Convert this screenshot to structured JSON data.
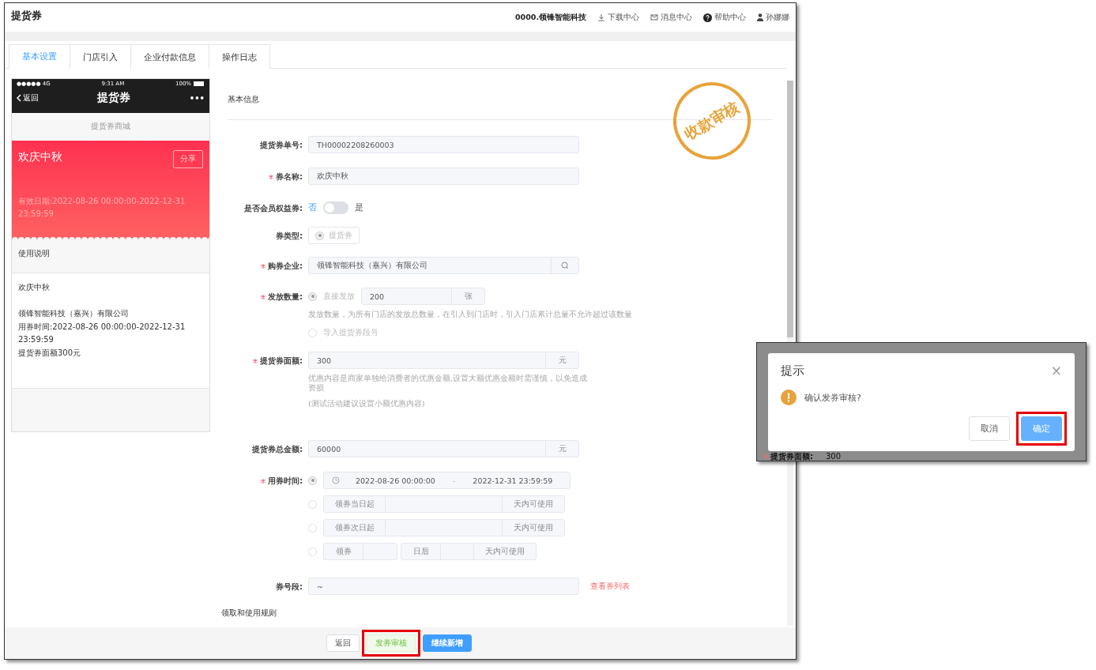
{
  "page_title": "提货券",
  "header_links": [
    {
      "kind": "company",
      "text": "0000.领锋智能科技"
    },
    {
      "kind": "download",
      "text": "下载中心"
    },
    {
      "kind": "message",
      "text": "消息中心"
    },
    {
      "kind": "help",
      "text": "帮助中心"
    },
    {
      "kind": "user",
      "text": "孙娜娜"
    }
  ],
  "tabs": [
    {
      "label": "基本设置",
      "selected": true
    },
    {
      "label": "门店引入",
      "selected": false
    },
    {
      "label": "企业付款信息",
      "selected": false
    },
    {
      "label": "操作日志",
      "selected": false
    }
  ],
  "stamp": "收款审核",
  "phone": {
    "carrier": "●●●●● 4G",
    "time": "9:31 AM",
    "battery": "100%",
    "back": "返回",
    "title": "提货券",
    "more": "•••",
    "shop_label": "提货券商城",
    "coupon": {
      "name": "欢庆中秋",
      "share": "分享",
      "validity": "有效日期:2022-08-26 00:00:00-2022-12-31 23:59:59"
    },
    "usage_title": "使用说明",
    "usage_blocks": [
      [
        "欢庆中秋"
      ],
      [
        "领锋智能科技（嘉兴）有限公司",
        "用券时间:2022-08-26 00:00:00-2022-12-31 23:59:59",
        "提货券面额300元"
      ]
    ]
  },
  "form": {
    "section_title": "基本信息",
    "fields": [
      {
        "kind": "text",
        "label": "提货券单号:",
        "required": false,
        "value": "TH00002208260003"
      },
      {
        "kind": "text",
        "label": "券名称:",
        "required": true,
        "value": "欢庆中秋"
      },
      {
        "kind": "switch",
        "label": "是否会员权益券:",
        "required": false,
        "off_label": "否",
        "on_label": "是",
        "on": false
      },
      {
        "kind": "radio_box",
        "label": "券类型:",
        "required": false,
        "option": "提货券",
        "selected": true
      },
      {
        "kind": "search",
        "label": "购券企业:",
        "required": true,
        "value": "领锋智能科技（嘉兴）有限公司"
      },
      {
        "kind": "quantity",
        "label": "发放数量:",
        "required": true,
        "options": [
          {
            "label": "直接发放",
            "selected": true,
            "value": "200",
            "unit": "张",
            "help": "发放数量，为所有门店的发放总数量，在引入到门店时，引入门店累计总量不允许超过该数量"
          },
          {
            "label": "导入提货券段号",
            "selected": false
          }
        ]
      },
      {
        "kind": "amount",
        "label": "提货券面额:",
        "required": true,
        "value": "300",
        "unit": "元",
        "help": [
          "优惠内容是商家单独给消费者的优惠金额,设置大额优惠金额时需谨慎，以免造成资损",
          "(测试活动建议设置小额优惠内容)"
        ]
      },
      {
        "kind": "amount",
        "label": "提货券总金额:",
        "required": false,
        "value": "60000",
        "unit": "元"
      },
      {
        "kind": "time",
        "label": "用券时间:",
        "required": true,
        "options": [
          {
            "kind": "range",
            "selected": true,
            "start": "2022-08-26 00:00:00",
            "separator": "-",
            "end": "2022-12-31 23:59:59"
          },
          {
            "kind": "days",
            "selected": false,
            "prefix": "领券当日起",
            "suffix": "天内可使用"
          },
          {
            "kind": "days",
            "selected": false,
            "prefix": "领券次日起",
            "suffix": "天内可使用"
          },
          {
            "kind": "delay",
            "selected": false,
            "prefix": "领券",
            "middle": "日后",
            "suffix": "天内可使用"
          }
        ]
      },
      {
        "kind": "range_link",
        "label": "券号段:",
        "required": false,
        "value": "~",
        "link": "查看券列表"
      }
    ],
    "next_section": "领取和使用规则"
  },
  "footer_buttons": [
    {
      "kind": "plain",
      "label": "返回",
      "highlighted": false
    },
    {
      "kind": "success",
      "label": "发券审核",
      "highlighted": true
    },
    {
      "kind": "primary",
      "label": "继续新增",
      "highlighted": false
    }
  ],
  "dialog": {
    "title": "提示",
    "close": "×",
    "message": "确认发券审核?",
    "buttons": [
      {
        "kind": "plain",
        "label": "取消",
        "highlighted": false
      },
      {
        "kind": "primary",
        "label": "确定",
        "highlighted": true
      }
    ],
    "background_peek": {
      "required": true,
      "label": "提货券面额:",
      "value": "300"
    }
  }
}
